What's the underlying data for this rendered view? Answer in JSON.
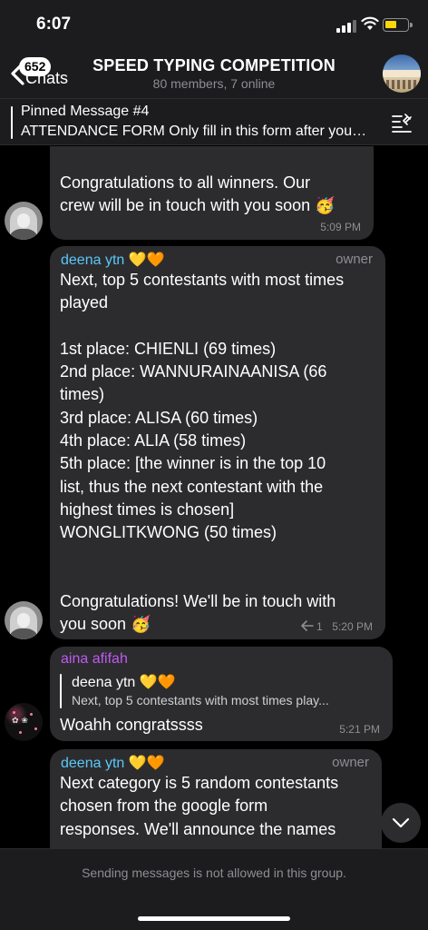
{
  "status_bar": {
    "time": "6:07"
  },
  "header": {
    "back_count": "652",
    "back_label": "Chats",
    "title": "SPEED TYPING COMPETITION",
    "subtitle": "80 members, 7 online"
  },
  "pinned": {
    "title": "Pinned Message #4",
    "text": "ATTENDANCE FORM Only fill in this form after you…"
  },
  "messages": [
    {
      "text": "Congratulations to all winners. Our\ncrew will be in touch with you soon 🥳",
      "time": "5:09 PM"
    },
    {
      "sender": "deena ytn 💛🧡",
      "role": "owner",
      "text": "Next, top 5 contestants with most times\nplayed\n\n1st place: CHIENLI (69 times)\n2nd place: WANNURAINAANISA (66\ntimes)\n3rd place: ALISA (60 times)\n4th place: ALIA (58 times)\n5th place: [the winner is in the top 10\nlist, thus the next contestant with the\nhighest times is chosen]\nWONGLITKWONG (50 times)\n\n\nCongratulations! We'll be in touch with\nyou soon 🥳",
      "replies": "1",
      "time": "5:20 PM"
    },
    {
      "sender": "aina afifah",
      "reply_to_name": "deena ytn 💛🧡",
      "reply_to_text": "Next, top 5 contestants with most times play...",
      "text": "Woahh congratssss",
      "time": "5:21 PM"
    },
    {
      "sender": "deena ytn 💛🧡",
      "role": "owner",
      "text": "Next category is 5 random contestants\nchosen from the google form\nresponses. We'll announce the names"
    }
  ],
  "footer": {
    "text": "Sending messages is not allowed in this group."
  },
  "colors": {
    "bubble": "#2c2c2e",
    "sender_owner": "#5ac8fa",
    "sender_member": "#bf5af2",
    "battery": "#ffd60a"
  },
  "icons": [
    "signal-icon",
    "wifi-icon",
    "battery-icon",
    "back-chevron-icon",
    "pinned-list-icon",
    "reply-arrow-icon",
    "chevron-down-icon"
  ]
}
